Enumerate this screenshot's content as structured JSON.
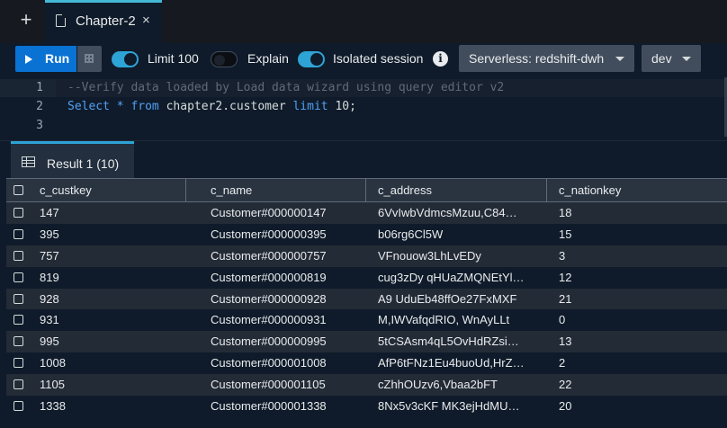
{
  "tabs": [
    {
      "label": "Chapter-2",
      "close": "×"
    }
  ],
  "new_tab": "+",
  "toolbar": {
    "run_label": "Run",
    "limit_label": "Limit 100",
    "explain_label": "Explain",
    "isolated_label": "Isolated session",
    "limit_on": true,
    "explain_on": false,
    "isolated_on": true,
    "connection": "Serverless: redshift-dwh",
    "database": "dev"
  },
  "editor": {
    "line_numbers": [
      "1",
      "2",
      "3"
    ],
    "line1": "--Verify data loaded by Load data wizard using query editor v2",
    "line2_select": "Select",
    "line2_star": "*",
    "line2_from": "from",
    "line2_table": "chapter2.customer",
    "line2_limit": "limit",
    "line2_end": "10;"
  },
  "results": {
    "tab_label": "Result 1 (10)",
    "columns": [
      "c_custkey",
      "c_name",
      "c_address",
      "c_nationkey"
    ],
    "rows": [
      [
        "147",
        "Customer#000000147",
        "6VvIwbVdmcsMzuu,C84…",
        "18"
      ],
      [
        "395",
        "Customer#000000395",
        "b06rg6Cl5W",
        "15"
      ],
      [
        "757",
        "Customer#000000757",
        "VFnouow3LhLvEDy",
        "3"
      ],
      [
        "819",
        "Customer#000000819",
        "cug3zDy qHUaZMQNEtYl…",
        "12"
      ],
      [
        "928",
        "Customer#000000928",
        "A9 UduEb48ffOe27FxMXF",
        "21"
      ],
      [
        "931",
        "Customer#000000931",
        "M,IWVafqdRIO, WnAyLLt",
        "0"
      ],
      [
        "995",
        "Customer#000000995",
        "5tCSAsm4qL5OvHdRZsi…",
        "13"
      ],
      [
        "1008",
        "Customer#000001008",
        "AfP6tFNz1Eu4buoUd,HrZ…",
        "2"
      ],
      [
        "1105",
        "Customer#000001105",
        "cZhhOUzv6,Vbaa2bFT",
        "22"
      ],
      [
        "1338",
        "Customer#000001338",
        "8Nx5v3cKF MK3ejHdMU…",
        "20"
      ]
    ]
  },
  "colors": {
    "accent": "#0972d3",
    "toggle_on": "#2ea3d5",
    "background": "#0f1b2a"
  },
  "icons": [
    "plus-icon",
    "file-icon",
    "close-icon",
    "play-icon",
    "grid-icon",
    "info-icon",
    "chevron-down-icon",
    "table-icon",
    "checkbox-icon"
  ]
}
